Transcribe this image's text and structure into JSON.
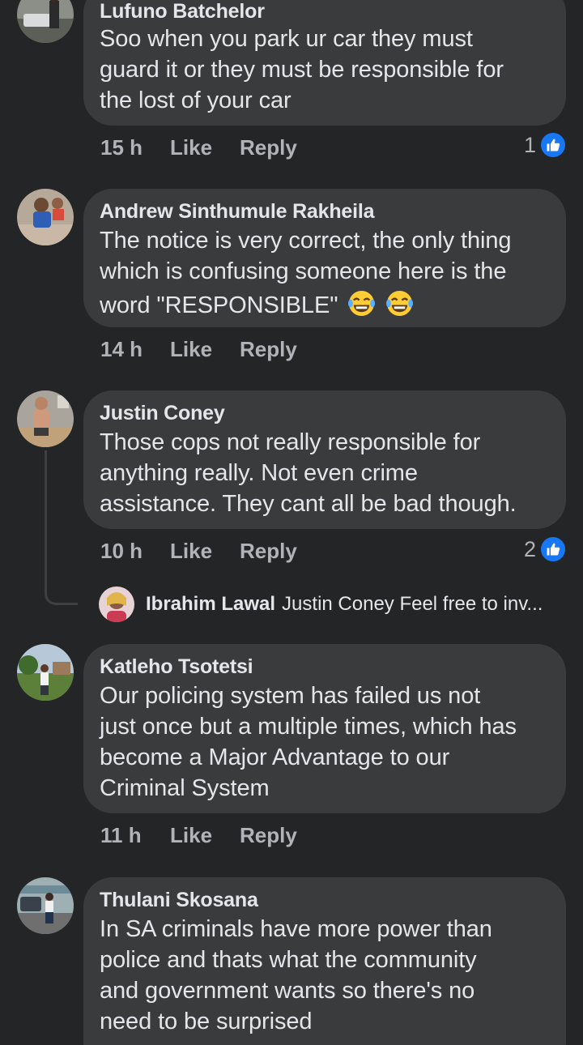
{
  "comments": [
    {
      "author": "Lufuno Batchelor",
      "lines": [
        "Soo when you park ur car they must",
        "guard it or they must be responsible for",
        "the lost of your car"
      ],
      "time": "15 h",
      "like": "Like",
      "reply": "Reply",
      "reactions": "1",
      "reaction_icon": "like-icon"
    },
    {
      "author": "Andrew Sinthumule Rakheila",
      "lines": [
        "The notice is very correct, the only thing",
        "which is confusing someone here is the",
        "word \"RESPONSIBLE\""
      ],
      "emojis": [
        "laughing-tears-emoji",
        "laughing-tears-emoji"
      ],
      "time": "14 h",
      "like": "Like",
      "reply": "Reply"
    },
    {
      "author": "Justin Coney",
      "lines": [
        "Those cops not really responsible for",
        "anything really. Not even crime",
        "assistance. They cant all be bad though."
      ],
      "time": "10 h",
      "like": "Like",
      "reply": "Reply",
      "reactions": "2",
      "reaction_icon": "like-icon",
      "reply_preview": {
        "author": "Ibrahim Lawal",
        "text": "Justin Coney Feel free to inv..."
      }
    },
    {
      "author": "Katleho Tsotetsi",
      "lines": [
        "Our policing system has failed us not",
        "just once but a multiple times, which has",
        "become a Major Advantage to our",
        "Criminal System"
      ],
      "time": "11 h",
      "like": "Like",
      "reply": "Reply"
    },
    {
      "author": "Thulani Skosana",
      "lines": [
        "In SA criminals have more power than",
        "police and thats what the community",
        "and government wants so there's no",
        "need to be surprised"
      ]
    }
  ],
  "colors": {
    "background": "#242526",
    "bubble": "#3a3b3c",
    "text": "#e4e6eb",
    "secondary_text": "#b0b3b8",
    "like_blue": "#1877f2"
  }
}
